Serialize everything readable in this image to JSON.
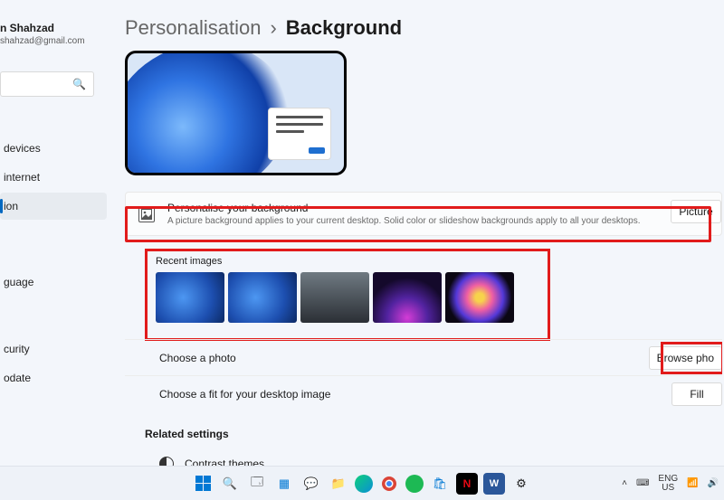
{
  "user": {
    "name": "n Shahzad",
    "email": "shahzad@gmail.com"
  },
  "search": {
    "placeholder": ""
  },
  "nav": {
    "items": [
      {
        "label": "devices"
      },
      {
        "label": "internet"
      },
      {
        "label": "ion"
      },
      {
        "label": "guage"
      },
      {
        "label": "curity"
      },
      {
        "label": "odate"
      }
    ],
    "selected_index": 2
  },
  "breadcrumb": {
    "t1": "Personalisation",
    "sep": "›",
    "t2": "Background"
  },
  "personalise": {
    "title": "Personalise your background",
    "desc": "A picture background applies to your current desktop. Solid color or slideshow backgrounds apply to all your desktops.",
    "dropdown_value": "Picture"
  },
  "recent": {
    "title": "Recent images",
    "thumbs": [
      "bloom-blue-1",
      "bloom-blue-2",
      "character-dark",
      "glow-magenta",
      "dark-ribbons"
    ]
  },
  "choose_photo": {
    "label": "Choose a photo",
    "button": "Browse pho"
  },
  "choose_fit": {
    "label": "Choose a fit for your desktop image",
    "value": "Fill"
  },
  "related": {
    "title": "Related settings",
    "items": [
      "Contrast themes"
    ]
  },
  "taskbar": {
    "apps": [
      "start",
      "search",
      "task-view",
      "widgets",
      "chat",
      "explorer",
      "edge",
      "chrome",
      "spotify",
      "store",
      "netflix",
      "word",
      "settings"
    ],
    "tray": {
      "lang_top": "ENG",
      "lang_bot": "US"
    }
  }
}
